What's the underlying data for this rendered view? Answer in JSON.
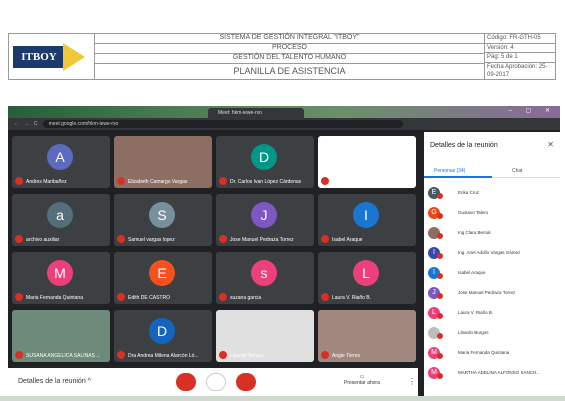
{
  "doc": {
    "logo_text": "ITBOY",
    "line1": "SISTEMA DE GESTIÓN INTEGRAL \"ITBOY\"",
    "line2": "PROCESO",
    "line3": "GESTIÓN DEL TALENTO HUMANO",
    "line4": "PLANILLA DE ASISTENCIA",
    "codigo": "Código: FR-GTH-05",
    "version": "Versión: 4",
    "pag": "Pág: 5 de 1",
    "fecha": "Fecha Aprobación: 25-09-2017"
  },
  "browser": {
    "tab_title": "Meet: hkm-iewe-rxo",
    "url": "meet.google.com/hkm-iewe-rxo"
  },
  "tiles": [
    {
      "name": "Andres Maribañez",
      "letter": "A",
      "color": "#5c6bc0"
    },
    {
      "name": "Elizabeth Camargo Vargas",
      "letter": "",
      "color": "#8d6e63"
    },
    {
      "name": "Dr. Carlos Ivan López Cárdenas",
      "letter": "D",
      "color": "#009688"
    },
    {
      "name": "Danna Medina",
      "letter": "",
      "color": "#ffffff"
    },
    {
      "name": "archivo auxiliar",
      "letter": "a",
      "color": "#546e7a"
    },
    {
      "name": "Samuel vargas lopez",
      "letter": "S",
      "color": "#78909c"
    },
    {
      "name": "Jose Manuel Pedraza Torrez",
      "letter": "J",
      "color": "#7e57c2"
    },
    {
      "name": "Isabel Araque",
      "letter": "I",
      "color": "#1976d2"
    },
    {
      "name": "Maria Fernanda Quintana",
      "letter": "M",
      "color": "#ec407a"
    },
    {
      "name": "Edith DE CASTRO",
      "letter": "E",
      "color": "#f4511e"
    },
    {
      "name": "suzana garcia",
      "letter": "s",
      "color": "#ec407a"
    },
    {
      "name": "Laura V. Riaño B.",
      "letter": "L",
      "color": "#ec407a"
    },
    {
      "name": "SUSANA ANGELICA SALINAS ...",
      "letter": "",
      "color": "#6d8a7a"
    },
    {
      "name": "Dra Andrea Milena Alarcón Ló...",
      "letter": "D",
      "color": "#1565c0"
    },
    {
      "name": "Libardo Burgos",
      "letter": "",
      "color": "#e0e0e0"
    },
    {
      "name": "Angie Torres",
      "letter": "",
      "color": "#a1887f"
    }
  ],
  "controls": {
    "details": "Detalles de la reunión",
    "present": "Presentar ahora"
  },
  "panel": {
    "title": "Detalles de la reunión",
    "people_tab": "Personas (34)",
    "chat_tab": "Chat",
    "people": [
      {
        "name": "Erika Cruz",
        "letter": "E",
        "color": "#455a64"
      },
      {
        "name": "Gustavo Talero",
        "letter": "G",
        "color": "#e64a19"
      },
      {
        "name": "Ing Clara Bernal",
        "letter": "",
        "color": "#8d6e63"
      },
      {
        "name": "Ing. Ariel Adolfo Vargas Gámez",
        "letter": "I",
        "color": "#3949ab"
      },
      {
        "name": "Isabel Araque",
        "letter": "I",
        "color": "#1976d2"
      },
      {
        "name": "Jose Manuel Pedraza Torrez",
        "letter": "J",
        "color": "#7e57c2"
      },
      {
        "name": "Laura V. Riaño B.",
        "letter": "L",
        "color": "#ec407a"
      },
      {
        "name": "Libardo Burgos",
        "letter": "",
        "color": "#bdbdbd"
      },
      {
        "name": "Maria Fernanda Quintana",
        "letter": "M",
        "color": "#ec407a"
      },
      {
        "name": "MARTHA ADELINA ALFONSO SANCH...",
        "letter": "M",
        "color": "#ec407a"
      }
    ]
  }
}
